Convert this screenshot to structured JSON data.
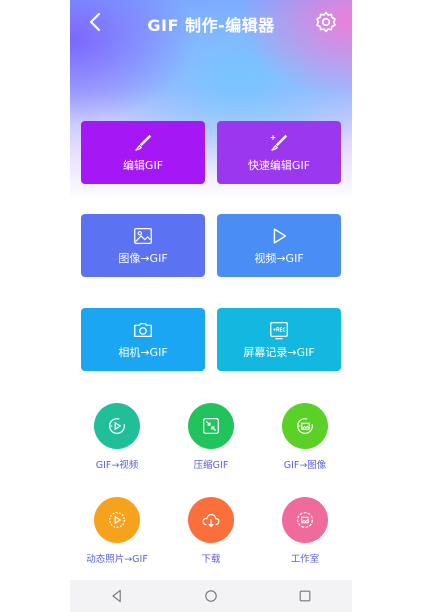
{
  "header": {
    "title": "GIF 制作-编辑器",
    "back_icon": "chevron-left-icon",
    "settings_icon": "gear-icon"
  },
  "cards": [
    {
      "label": "编辑GIF",
      "icon": "brush-icon",
      "color": "#a617f5"
    },
    {
      "label": "快速编辑GIF",
      "icon": "brush-edit-icon",
      "color": "#9b37ee"
    },
    {
      "label": "图像→GIF",
      "icon": "image-icon",
      "color": "#5b73f2"
    },
    {
      "label": "视频→GIF",
      "icon": "play-icon",
      "color": "#4a8df4"
    },
    {
      "label": "相机→GIF",
      "icon": "camera-icon",
      "color": "#1aa6f2"
    },
    {
      "label": "屏幕记录→GIF",
      "icon": "rec-icon",
      "color": "#12b8e0"
    }
  ],
  "circles": [
    {
      "label": "GIF→视频",
      "icon": "video-convert-icon",
      "color": "#20bf9a"
    },
    {
      "label": "压缩GIF",
      "icon": "compress-icon",
      "color": "#21c45c"
    },
    {
      "label": "GIF→图像",
      "icon": "image-convert-icon",
      "color": "#5bd127"
    },
    {
      "label": "动态照片→GIF",
      "icon": "live-photo-icon",
      "color": "#f7a21c"
    },
    {
      "label": "下载",
      "icon": "cloud-download-icon",
      "color": "#fb6f3c"
    },
    {
      "label": "工作室",
      "icon": "studio-icon",
      "color": "#f16a9c"
    }
  ],
  "nav": {
    "back": "triangle-back-icon",
    "home": "circle-home-icon",
    "recents": "square-recents-icon"
  }
}
